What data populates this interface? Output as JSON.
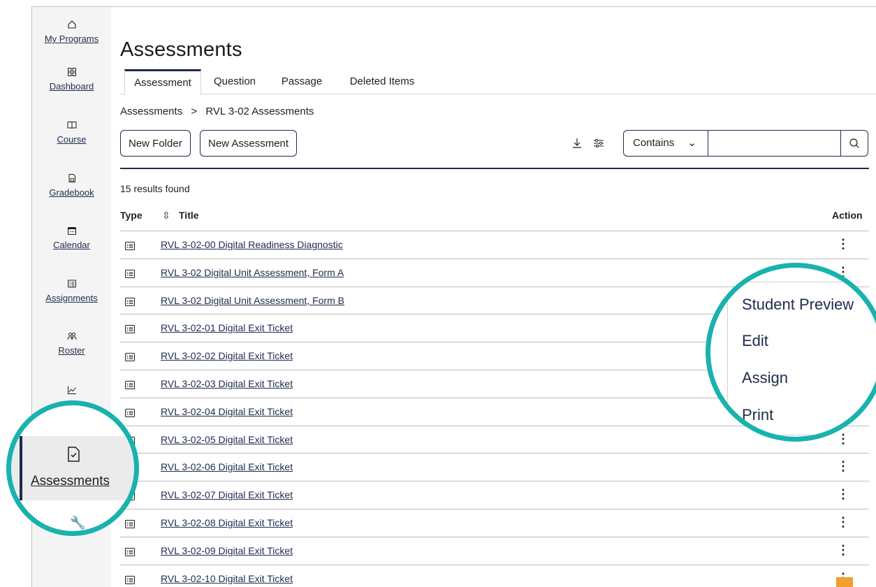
{
  "sidebar": {
    "items": [
      {
        "label": "My Programs",
        "icon": "home-icon"
      },
      {
        "label": "Dashboard",
        "icon": "dashboard-icon"
      },
      {
        "label": "Course",
        "icon": "book-icon"
      },
      {
        "label": "Gradebook",
        "icon": "gradebook-icon"
      },
      {
        "label": "Calendar",
        "icon": "calendar-icon"
      },
      {
        "label": "Assignments",
        "icon": "assignments-icon"
      },
      {
        "label": "Roster",
        "icon": "roster-icon"
      },
      {
        "label": "",
        "icon": "chart-icon"
      }
    ]
  },
  "page": {
    "title": "Assessments",
    "tabs": [
      "Assessment",
      "Question",
      "Passage",
      "Deleted Items"
    ],
    "active_tab": "Assessment",
    "breadcrumb": [
      "Assessments",
      ">",
      "RVL 3-02 Assessments"
    ]
  },
  "toolbar": {
    "new_folder": "New Folder",
    "new_assessment": "New Assessment",
    "filter_select": "Contains",
    "search_value": ""
  },
  "results": {
    "count_text": "15 results found",
    "headers": {
      "type": "Type",
      "title": "Title",
      "action": "Action"
    },
    "rows": [
      "RVL 3-02-00 Digital Readiness Diagnostic",
      "RVL 3-02 Digital Unit Assessment, Form A",
      "RVL 3-02 Digital Unit Assessment, Form B",
      "RVL 3-02-01 Digital Exit Ticket",
      "RVL 3-02-02 Digital Exit Ticket",
      "RVL 3-02-03 Digital Exit Ticket",
      "RVL 3-02-04 Digital Exit Ticket",
      "RVL 3-02-05 Digital Exit Ticket",
      "RVL 3-02-06 Digital Exit Ticket",
      "RVL 3-02-07 Digital Exit Ticket",
      "RVL 3-02-08 Digital Exit Ticket",
      "RVL 3-02-09 Digital Exit Ticket",
      "RVL 3-02-10 Digital Exit Ticket"
    ]
  },
  "zoom_left": {
    "label": "Assessments"
  },
  "action_menu": {
    "items": [
      "Student Preview",
      "Edit",
      "Assign",
      "Print"
    ]
  },
  "colors": {
    "accent": "#19b2ad",
    "navy": "#1f2b4d",
    "badge": "#f0a030"
  }
}
